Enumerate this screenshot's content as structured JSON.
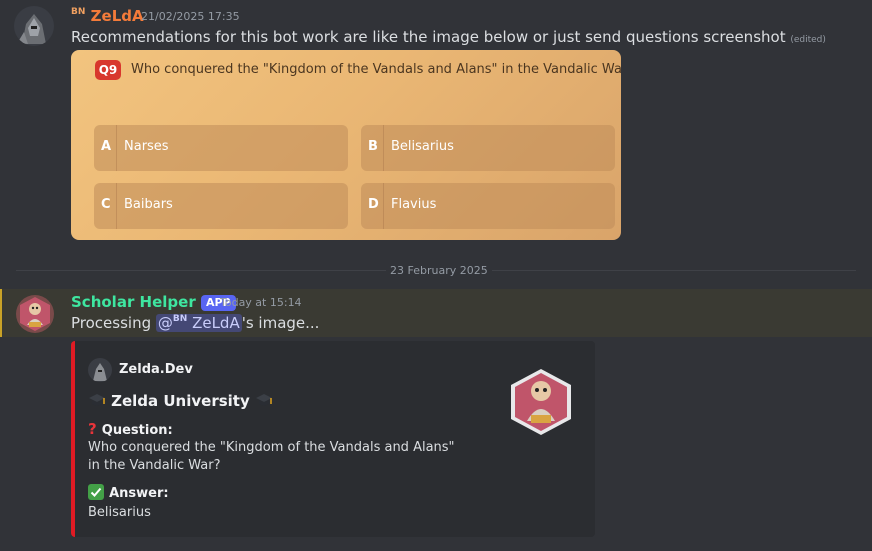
{
  "message1": {
    "badge": "BN",
    "username": "ZeLdA",
    "username_color": "#f47b3a",
    "timestamp": "21/02/2025 17:35",
    "text": "Recommendations for this bot work are like the image below or just send questions screenshot",
    "edited": "(edited)"
  },
  "quiz_image": {
    "number": "Q9",
    "question": "Who conquered the \"Kingdom of the Vandals and Alans\" in the Vandalic War?",
    "options": [
      {
        "letter": "A",
        "text": "Narses"
      },
      {
        "letter": "B",
        "text": "Belisarius"
      },
      {
        "letter": "C",
        "text": "Baibars"
      },
      {
        "letter": "D",
        "text": "Flavius"
      }
    ]
  },
  "divider": {
    "date": "23 February 2025"
  },
  "message2": {
    "username": "Scholar Helper",
    "username_color": "#3ee6a0",
    "app_tag": "APP",
    "timestamp": "Today at 15:14",
    "text_before": "Processing ",
    "mention_at": "@",
    "mention_badge": "BN",
    "mention_name": "ZeLdA",
    "text_after": "'s image..."
  },
  "embed": {
    "accent_color": "#e01b24",
    "author": "Zelda.Dev",
    "title": "Zelda University",
    "title_icon": "graduation-cap-icon",
    "question_label": "Question:",
    "question_icon": "red-question-mark-icon",
    "question_text": "Who conquered the \"Kingdom of the Vandals and Alans\" in the Vandalic War?",
    "answer_label": "Answer:",
    "answer_icon": "green-check-icon",
    "answer_text": "Belisarius"
  }
}
